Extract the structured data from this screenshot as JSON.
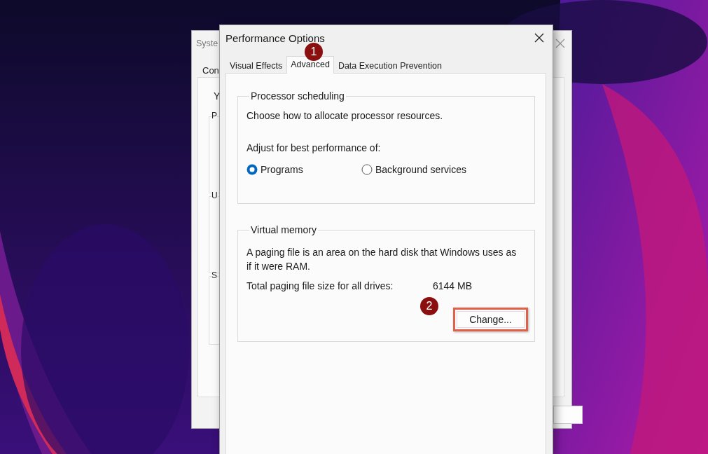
{
  "back_window": {
    "title": "Syste",
    "tab": "Con",
    "intro": "Y",
    "group_labels": [
      "P",
      "U",
      "S"
    ]
  },
  "dialog": {
    "title": "Performance Options",
    "tabs": [
      {
        "label": "Visual Effects",
        "selected": false
      },
      {
        "label": "Advanced",
        "selected": true
      },
      {
        "label": "Data Execution Prevention",
        "selected": false
      }
    ],
    "processor_scheduling": {
      "title": "Processor scheduling",
      "description": "Choose how to allocate processor resources.",
      "prompt": "Adjust for best performance of:",
      "options": [
        {
          "label": "Programs",
          "selected": true
        },
        {
          "label": "Background services",
          "selected": false
        }
      ]
    },
    "virtual_memory": {
      "title": "Virtual memory",
      "description": "A paging file is an area on the hard disk that Windows uses as if it were RAM.",
      "total_label": "Total paging file size for all drives:",
      "total_value": "6144 MB",
      "button": "Change...",
      "highlighted": true
    }
  },
  "annotations": [
    {
      "label": "1"
    },
    {
      "label": "2"
    }
  ]
}
